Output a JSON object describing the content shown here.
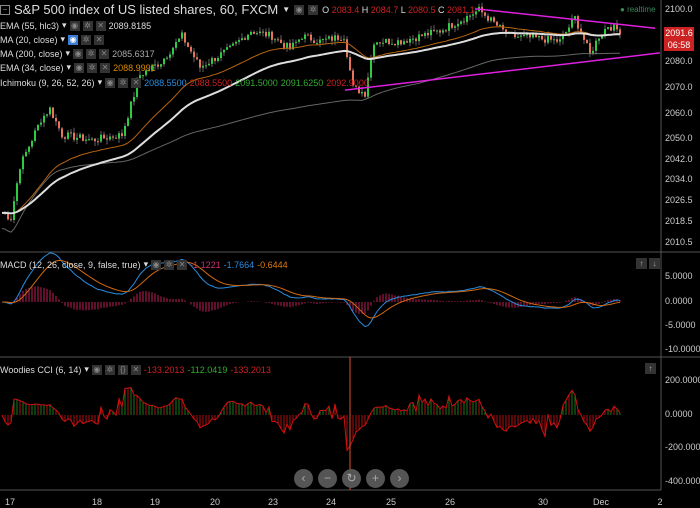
{
  "header": {
    "title": "S&P 500 index of US listed shares, 60, FXCM",
    "o_label": "O",
    "o": "2083.4",
    "h_label": "H",
    "h": "2084.7",
    "l_label": "L",
    "l": "2080.5",
    "c_label": "C",
    "c": "2081.1",
    "realtime": "realtime"
  },
  "indicators": [
    {
      "label": "EMA (55, hlc3)",
      "values": [
        "2089.8185"
      ]
    },
    {
      "label": "MA (20, close)",
      "values": []
    },
    {
      "label": "MA (200, close)",
      "values": [
        "2085.6317"
      ]
    },
    {
      "label": "EMA (34, close)",
      "values": [
        "2088.9991"
      ]
    },
    {
      "label": "Ichimoku (9, 26, 52, 26)",
      "values": [
        "2088.5500",
        "2088.5500",
        "2091.5000",
        "2091.6250",
        "2092.9000"
      ]
    }
  ],
  "macd": {
    "label": "MACD (12, 26, close, 9, false, true)",
    "values": [
      "-1.1221",
      "-1.7664",
      "-0.6444"
    ]
  },
  "cci": {
    "label": "Woodies CCI (6, 14)",
    "values": [
      "-133.2013",
      "-112.0419",
      "-133.2013"
    ]
  },
  "price_axis": [
    "2100.0",
    "2080.0",
    "2070.0",
    "2060.0",
    "2050.0",
    "2042.0",
    "2034.0",
    "2026.5",
    "2018.5",
    "2010.5"
  ],
  "price_badge": "2091.6",
  "countdown": "06:58",
  "macd_axis": [
    "5.0000",
    "0.0000",
    "-5.0000",
    "-10.0000"
  ],
  "cci_axis": [
    "200.0000",
    "0.0000",
    "-200.0000",
    "-400.0000"
  ],
  "x_axis": [
    "17",
    "18",
    "19",
    "20",
    "23",
    "24",
    "25",
    "26",
    "30",
    "Dec",
    "2"
  ],
  "nav": {
    "left": "‹",
    "minus": "−",
    "reset": "↻",
    "plus": "+",
    "right": "›"
  },
  "colors": {
    "up": "#2ecc40",
    "down": "#e8735a",
    "trend": "#e020e0",
    "ema55": "#dddddd",
    "ma200": "#666666",
    "ema34": "#b8650f"
  },
  "chart_data": {
    "type": "candlestick",
    "price_path": {
      "bar": [
        0,
        3,
        6,
        13,
        16,
        20,
        30,
        40,
        46,
        53,
        60,
        66,
        76,
        83,
        90,
        96,
        100,
        106,
        114,
        117,
        121,
        124,
        133,
        146,
        156,
        159,
        169,
        179,
        186,
        191,
        196,
        199,
        202,
        206
      ],
      "close": [
        2022,
        2020,
        2040,
        2058,
        2062,
        2052,
        2050,
        2052,
        2075,
        2080,
        2090,
        2078,
        2085,
        2092,
        2090,
        2085,
        2090,
        2088,
        2090,
        2070,
        2068,
        2088,
        2088,
        2092,
        2098,
        2100,
        2090,
        2089,
        2088,
        2097,
        2083,
        2090,
        2094,
        2092
      ]
    },
    "trendlines": [
      {
        "bar": [
          157.7,
          217.7
        ],
        "price": [
          2100.5,
          2093
        ]
      },
      {
        "bar": [
          114.3,
          219.3
        ],
        "price": [
          2069.2,
          2083.5
        ]
      }
    ],
    "price_range": [
      2008,
      2104
    ],
    "macd_range": [
      -11,
      7
    ],
    "cci_range": [
      -420,
      320
    ]
  }
}
